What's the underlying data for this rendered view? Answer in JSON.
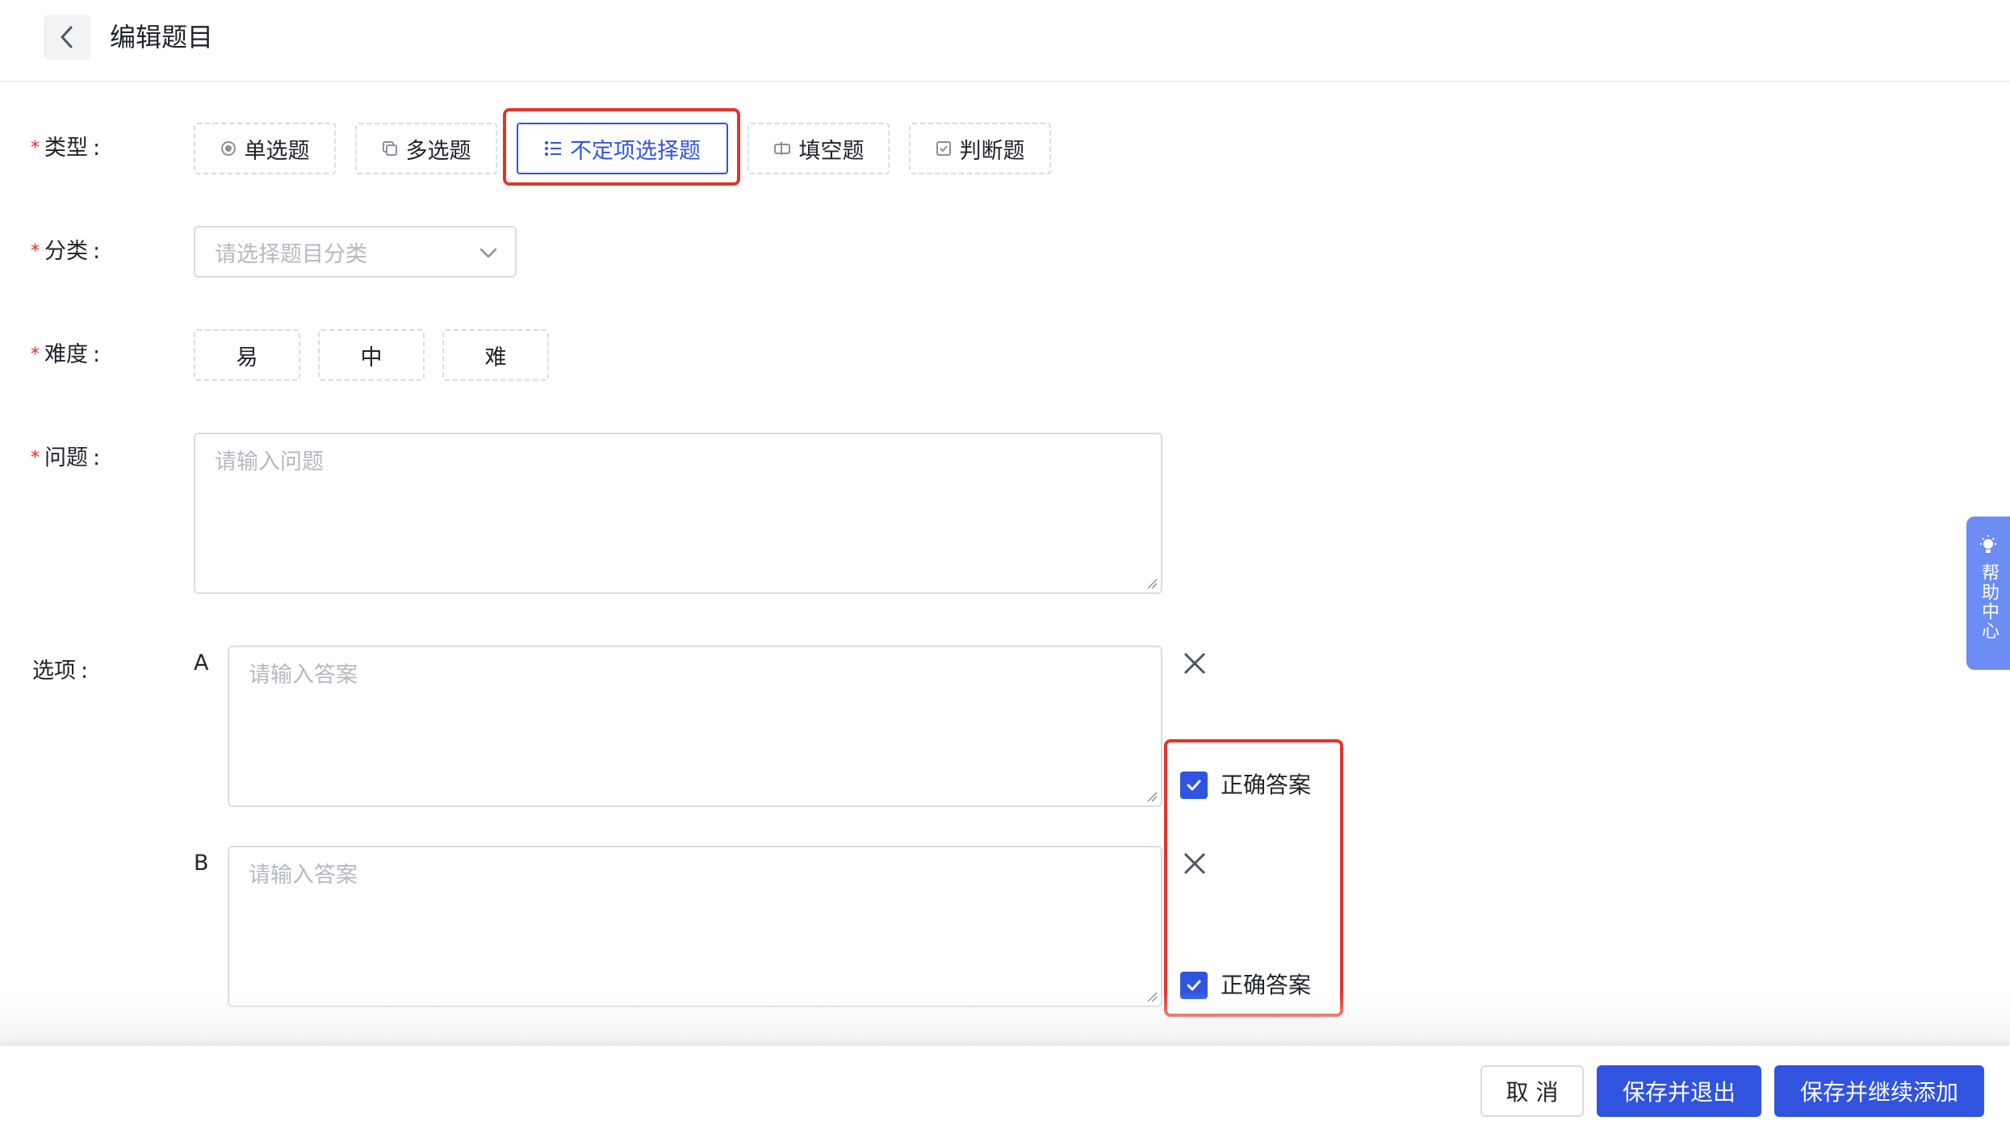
{
  "header": {
    "title": "编辑题目"
  },
  "form": {
    "type": {
      "label": "类型",
      "options": [
        "单选题",
        "多选题",
        "不定项选择题",
        "填空题",
        "判断题"
      ],
      "selected": "不定项选择题"
    },
    "category": {
      "label": "分类",
      "placeholder": "请选择题目分类"
    },
    "difficulty": {
      "label": "难度",
      "options": [
        "易",
        "中",
        "难"
      ]
    },
    "question": {
      "label": "问题",
      "placeholder": "请输入问题"
    },
    "options": {
      "label": "选项",
      "items": [
        {
          "letter": "A",
          "placeholder": "请输入答案",
          "correct_label": "正确答案",
          "checked": true
        },
        {
          "letter": "B",
          "placeholder": "请输入答案",
          "correct_label": "正确答案",
          "checked": true
        }
      ]
    }
  },
  "help": {
    "label": "帮助中心"
  },
  "footer": {
    "cancel": "取 消",
    "save_exit": "保存并退出",
    "save_continue": "保存并继续添加"
  },
  "colors": {
    "primary": "#3154e0",
    "highlight": "#e0362a",
    "required": "#f5222d"
  }
}
